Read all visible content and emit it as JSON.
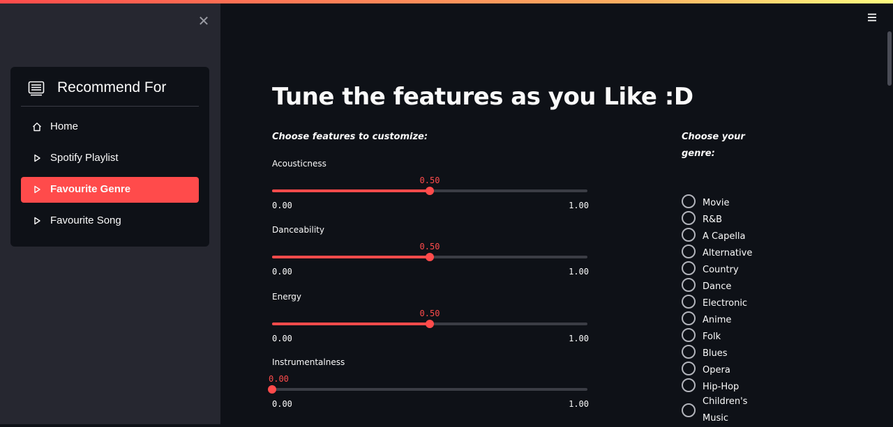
{
  "sidebar": {
    "close_glyph": "✕",
    "menu": {
      "title": "Recommend For",
      "title_icon": "list-card-icon",
      "items": [
        {
          "label": "Home",
          "icon": "home-icon"
        },
        {
          "label": "Spotify Playlist",
          "icon": "play-outline-icon"
        },
        {
          "label": "Favourite Genre",
          "icon": "play-outline-icon",
          "active": true
        },
        {
          "label": "Favourite Song",
          "icon": "play-outline-icon"
        }
      ]
    }
  },
  "header": {
    "menu_icon": "hamburger-icon"
  },
  "main": {
    "title": "Tune the features as you Like :D",
    "features_heading": "Choose features to customize:",
    "sliders": [
      {
        "label": "Acousticness",
        "value_text": "0.50",
        "value": 0.5,
        "min": "0.00",
        "max": "1.00"
      },
      {
        "label": "Danceability",
        "value_text": "0.50",
        "value": 0.5,
        "min": "0.00",
        "max": "1.00"
      },
      {
        "label": "Energy",
        "value_text": "0.50",
        "value": 0.5,
        "min": "0.00",
        "max": "1.00"
      },
      {
        "label": "Instrumentalness",
        "value_text": "0.00",
        "value": 0.0,
        "min": "0.00",
        "max": "1.00"
      }
    ],
    "genre_heading_line1": "Choose your",
    "genre_heading_line2": "genre:",
    "genres": [
      "Movie",
      "R&B",
      "A Capella",
      "Alternative",
      "Country",
      "Dance",
      "Electronic",
      "Anime",
      "Folk",
      "Blues",
      "Opera",
      "Hip-Hop",
      "Children's",
      "Music"
    ]
  },
  "colors": {
    "accent": "#ff4b4b",
    "background": "#0e1117",
    "sidebar": "#262730",
    "text": "#fafafa"
  }
}
